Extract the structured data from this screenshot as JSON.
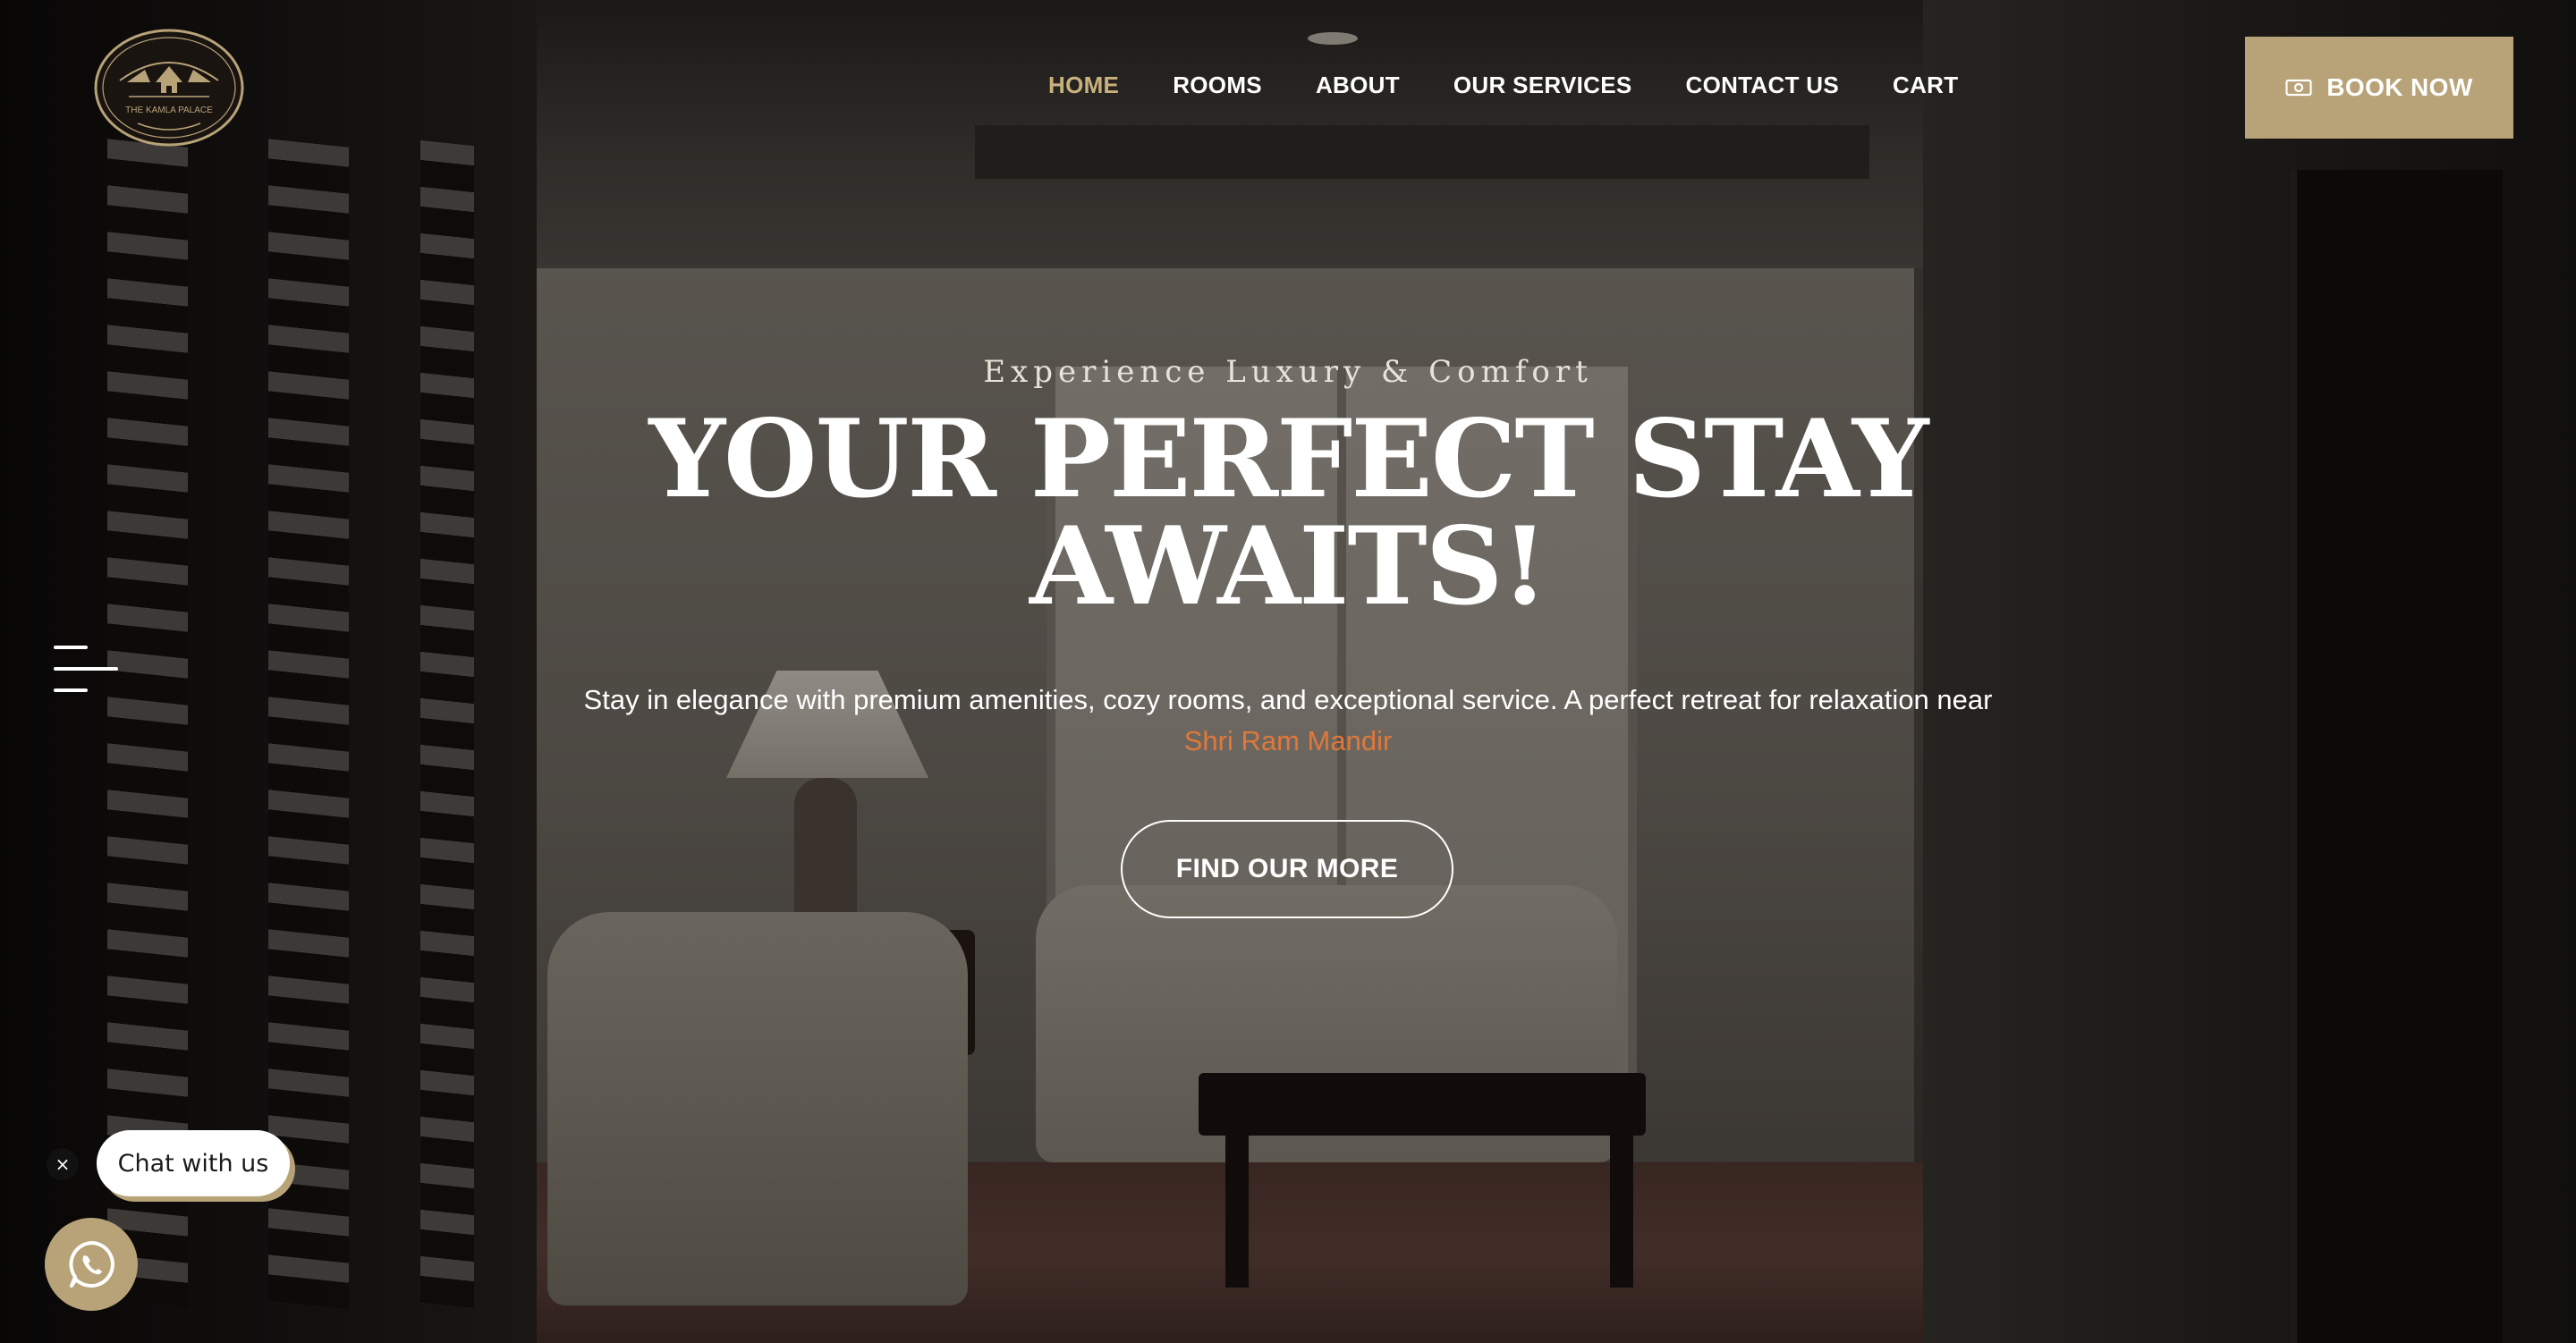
{
  "brand": {
    "logo_text": "THE KAMLA PALACE",
    "accent_color": "#b8a378",
    "highlight_color": "#e0783a"
  },
  "nav": {
    "items": [
      {
        "label": "HOME",
        "active": true
      },
      {
        "label": "ROOMS",
        "active": false
      },
      {
        "label": "ABOUT",
        "active": false
      },
      {
        "label": "OUR SERVICES",
        "active": false
      },
      {
        "label": "CONTACT US",
        "active": false
      },
      {
        "label": "CART",
        "active": false
      }
    ]
  },
  "header": {
    "book_button_label": "BOOK NOW",
    "book_button_icon": "money-icon"
  },
  "hero": {
    "eyebrow": "Experience Luxury & Comfort",
    "title_line1": "YOUR PERFECT STAY",
    "title_line2": "AWAITS!",
    "description": "Stay in elegance with premium amenities, cozy rooms, and exceptional service. A perfect retreat for relaxation near",
    "highlight": "Shri Ram Mandir",
    "cta_label": "FIND OUR MORE"
  },
  "chat": {
    "close_glyph": "×",
    "bubble_label": "Chat with us",
    "whatsapp_icon": "whatsapp-icon"
  }
}
